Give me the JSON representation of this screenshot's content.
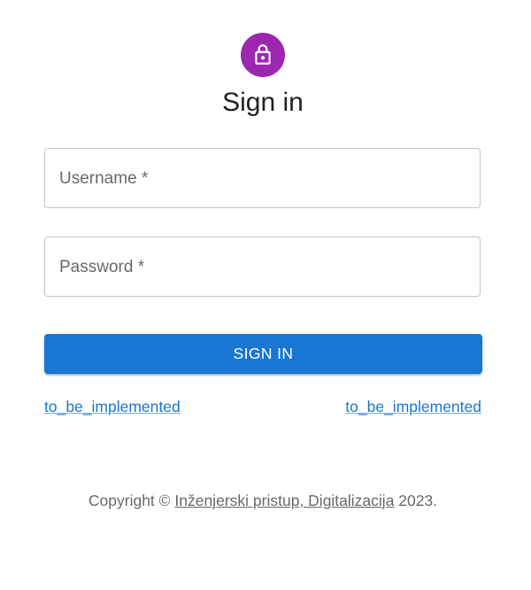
{
  "colors": {
    "avatar_bg": "#9c27b0",
    "primary": "#1976d2",
    "border": "#c4c4c4"
  },
  "avatar": {
    "icon": "lock-icon"
  },
  "title": "Sign in",
  "form": {
    "username": {
      "label": "Username *",
      "value": ""
    },
    "password": {
      "label": "Password *",
      "value": ""
    },
    "submit_label": "SIGN IN"
  },
  "links": {
    "left": "to_be_implemented",
    "right": "to_be_implemented"
  },
  "footer": {
    "prefix": "Copyright © ",
    "link": "Inženjerski pristup, Digitalizacija",
    "suffix": " 2023."
  }
}
